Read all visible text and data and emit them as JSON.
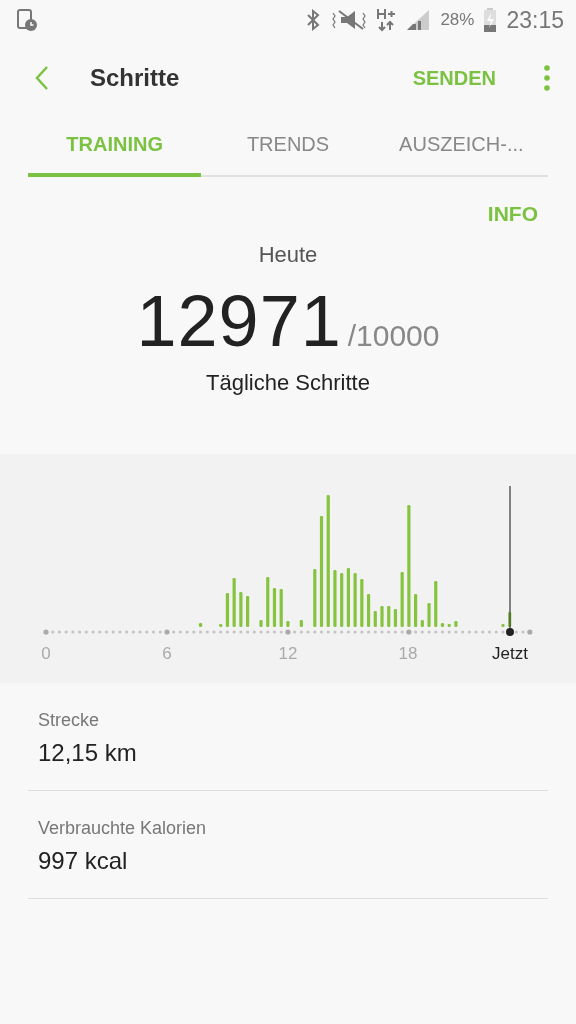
{
  "status_bar": {
    "battery": "28%",
    "time": "23:15"
  },
  "header": {
    "title": "Schritte",
    "action": "SENDEN"
  },
  "tabs": [
    {
      "label": "TRAINING",
      "selected": true
    },
    {
      "label": "TRENDS",
      "selected": false
    },
    {
      "label": "AUSZEICH-...",
      "selected": false
    }
  ],
  "info_link": "INFO",
  "summary": {
    "period": "Heute",
    "steps": "12971",
    "goal": "/10000",
    "caption": "Tägliche Schritte"
  },
  "activity_chart": {
    "axis_labels": [
      {
        "label": "0",
        "kind": "hour"
      },
      {
        "label": "6",
        "kind": "hour"
      },
      {
        "label": "12",
        "kind": "hour"
      },
      {
        "label": "18",
        "kind": "hour"
      },
      {
        "label": "Jetzt",
        "kind": "now"
      }
    ]
  },
  "stats": [
    {
      "label": "Strecke",
      "value": "12,15 km"
    },
    {
      "label": "Verbrauchte Kalorien",
      "value": "997 kcal"
    }
  ]
}
